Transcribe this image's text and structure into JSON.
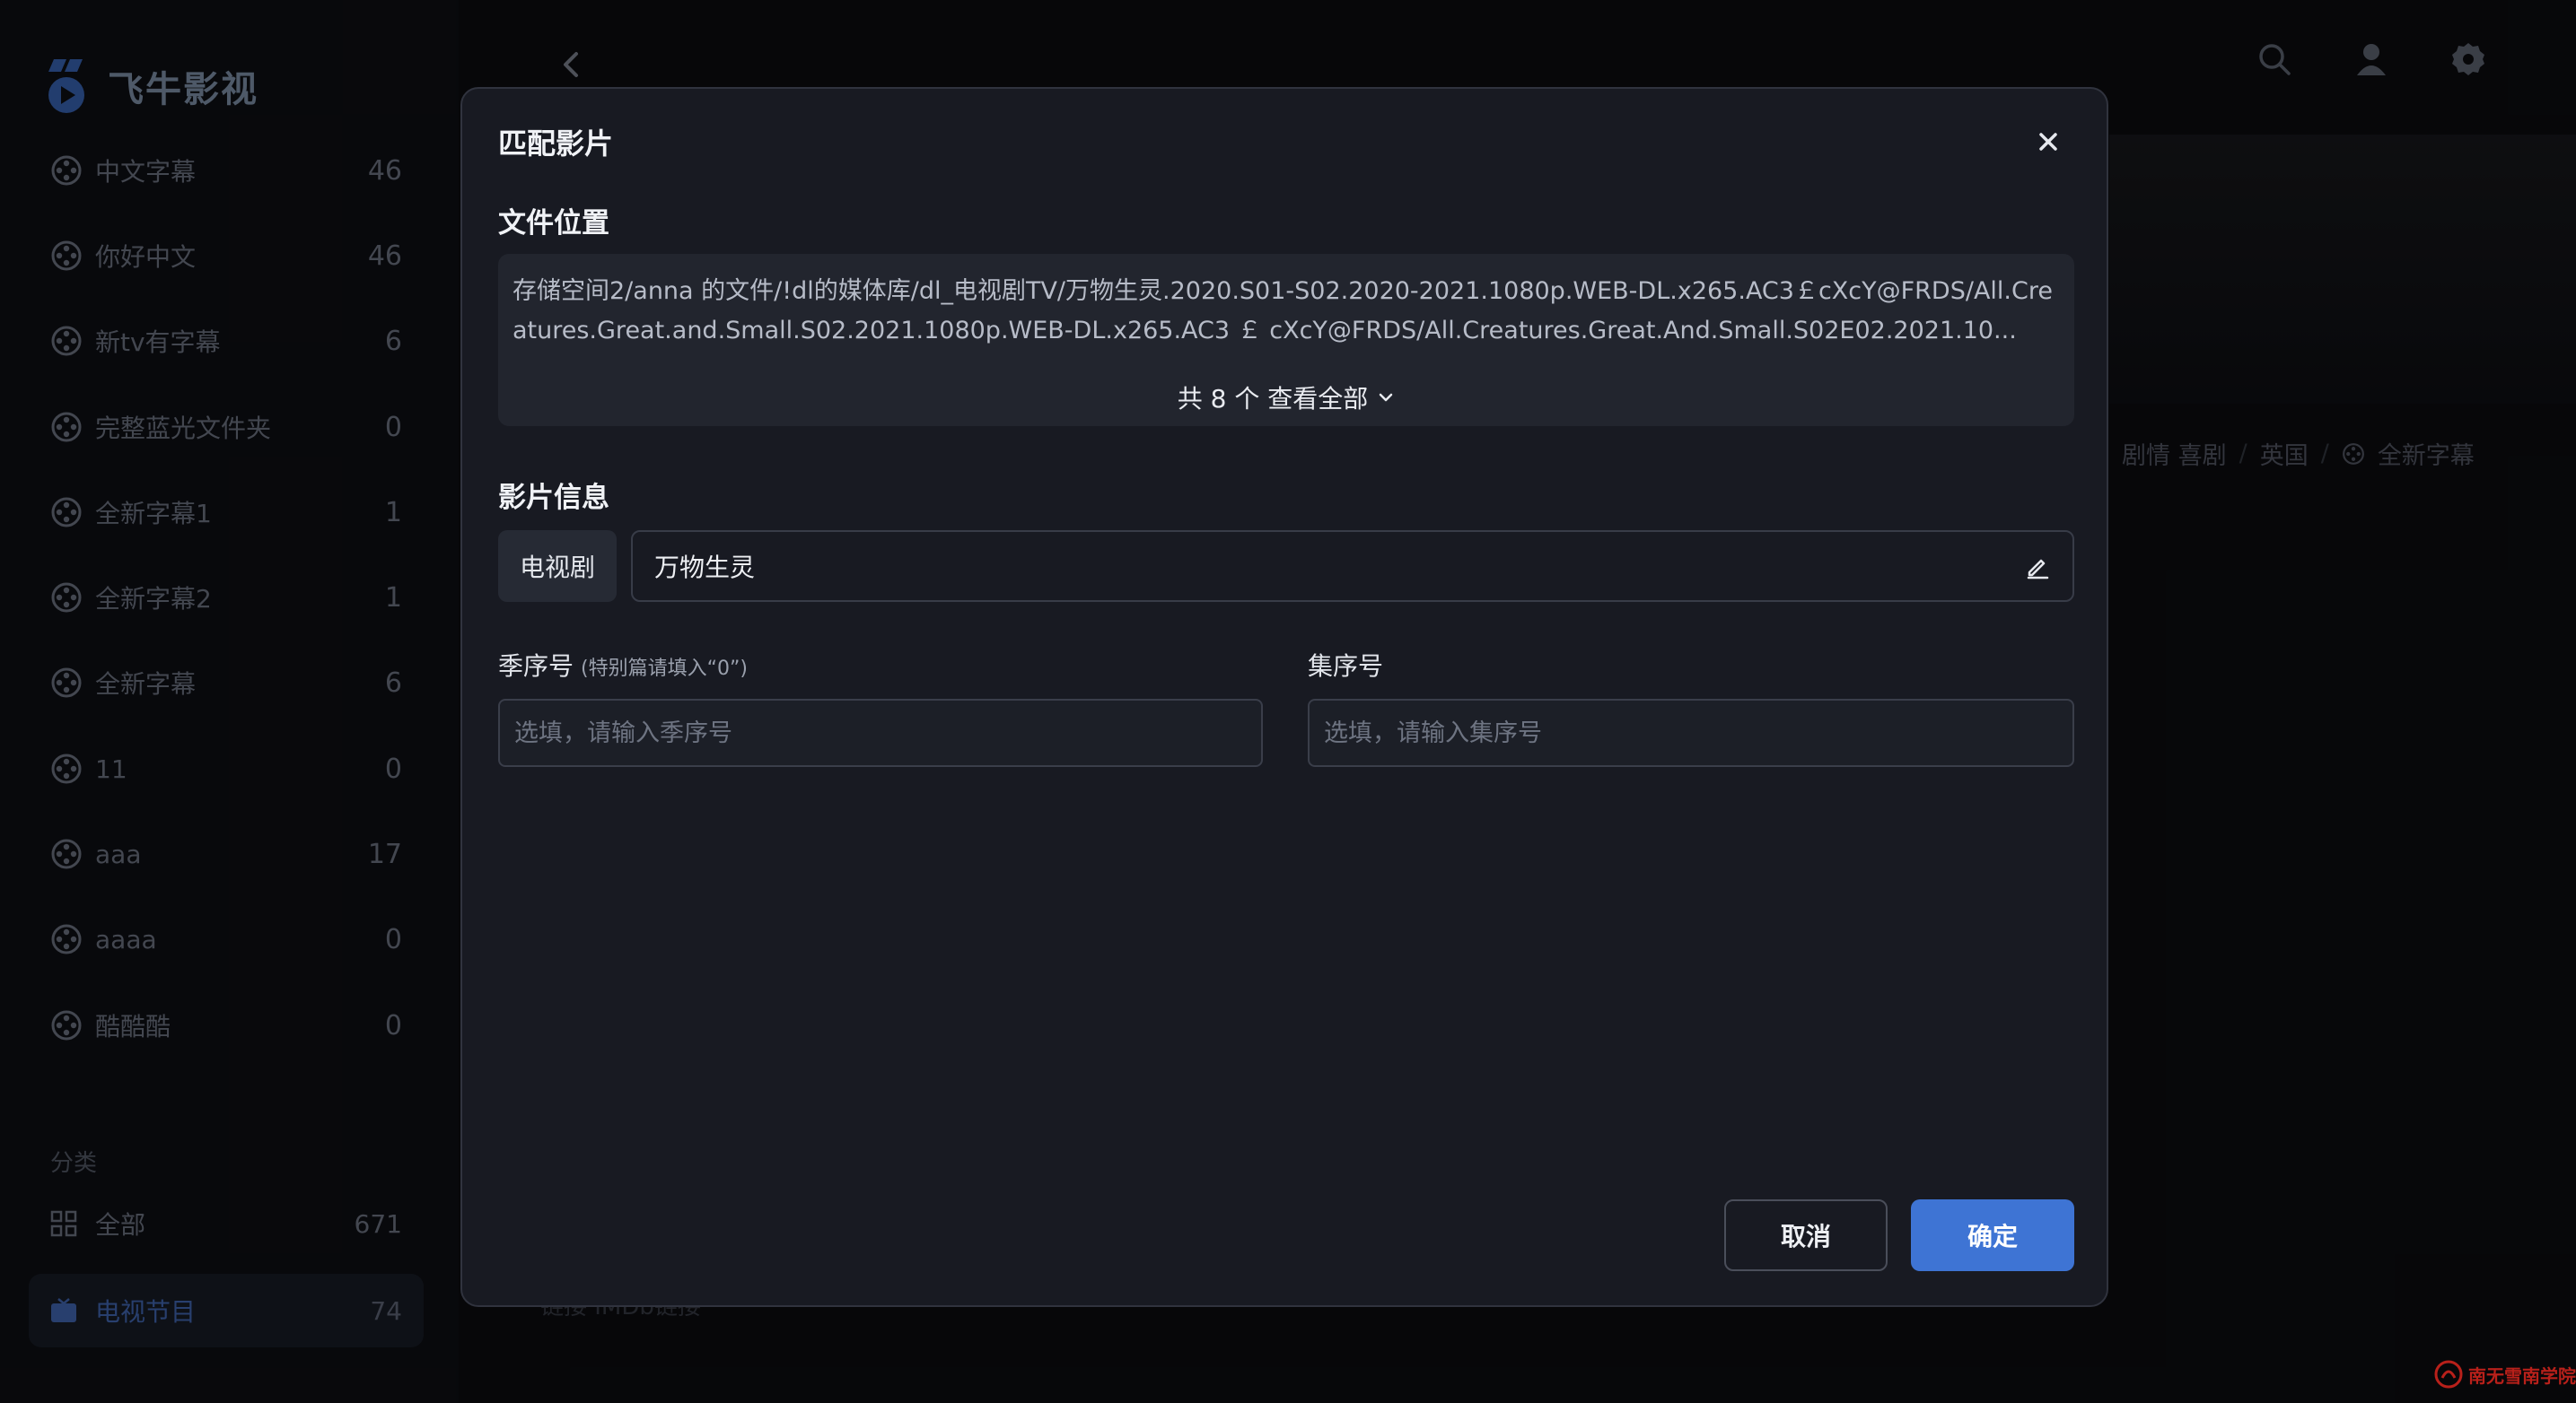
{
  "app": {
    "name": "飞牛影视"
  },
  "sidebar": {
    "libraries": [
      {
        "label": "中文字幕",
        "count": "46"
      },
      {
        "label": "你好中文",
        "count": "46"
      },
      {
        "label": "新tv有字幕",
        "count": "6"
      },
      {
        "label": "完整蓝光文件夹",
        "count": "0"
      },
      {
        "label": "全新字幕1",
        "count": "1"
      },
      {
        "label": "全新字幕2",
        "count": "1"
      },
      {
        "label": "全新字幕",
        "count": "6"
      },
      {
        "label": "11",
        "count": "0"
      },
      {
        "label": "aaa",
        "count": "17"
      },
      {
        "label": "aaaa",
        "count": "0"
      },
      {
        "label": "酷酷酷",
        "count": "0"
      }
    ],
    "category_title": "分类",
    "categories": [
      {
        "label": "全部",
        "count": "671",
        "icon": "grid-icon"
      },
      {
        "label": "电视节目",
        "count": "74",
        "icon": "tv-icon",
        "active": true
      }
    ]
  },
  "background": {
    "tags": [
      "剧情 喜剧",
      "英国",
      "全新字幕"
    ],
    "tag_separator": "/",
    "bottom_ghost": "链接  IMDb链接"
  },
  "dialog": {
    "title": "匹配影片",
    "file_location_label": "文件位置",
    "file_path": "存储空间2/anna 的文件/!dl的媒体库/dl_电视剧TV/万物生灵.2020.S01-S02.2020-2021.1080p.WEB-DL.x265.AC3￡cXcY@FRDS/All.Creatures.Great.and.Small.S02.2021.1080p.WEB-DL.x265.AC3 ￡ cXcY@FRDS/All.Creatures.Great.And.Small.S02E02.2021.10...",
    "show_all": "共 8 个 查看全部",
    "info_label": "影片信息",
    "media_type": "电视剧",
    "media_title": "万物生灵",
    "season_label": "季序号",
    "season_hint": "(特别篇请填入“0”)",
    "season_placeholder": "选填，请输入季序号",
    "episode_label": "集序号",
    "episode_placeholder": "选填，请输入集序号",
    "cancel": "取消",
    "confirm": "确定"
  },
  "colors": {
    "accent": "#3e74d4",
    "active_nav": "#4a74c9",
    "dialog_bg": "#181a22"
  },
  "watermark": "南无雪南学院"
}
